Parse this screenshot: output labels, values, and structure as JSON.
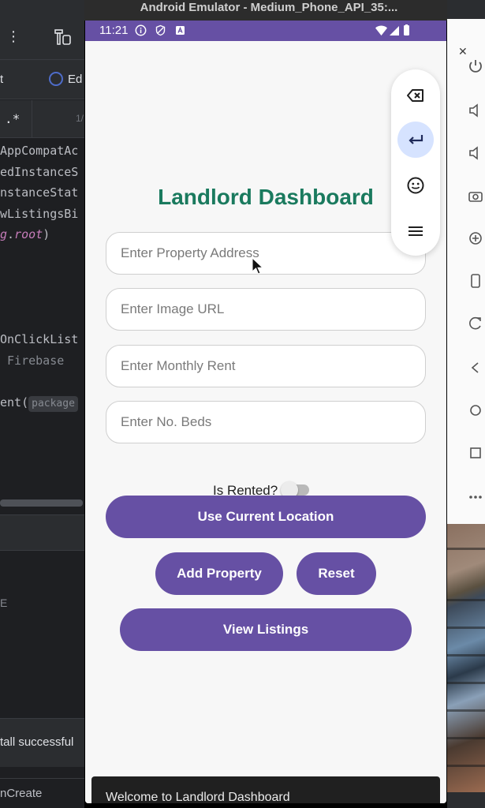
{
  "ide": {
    "find_regex": ".*",
    "find_count": "1/",
    "tab_left": "t",
    "tab_right": "Ed",
    "code_lines": [
      {
        "text": "AppCompatAc",
        "style": "plain"
      },
      {
        "text": "edInstanceS",
        "style": "plain"
      },
      {
        "text": "nstanceStat",
        "style": "plain"
      },
      {
        "text": "wListingsBi",
        "style": "plain"
      },
      {
        "text": "g.root)",
        "style": "root"
      },
      {
        "text": "",
        "style": "plain"
      },
      {
        "text": "",
        "style": "plain"
      },
      {
        "text": "",
        "style": "plain"
      },
      {
        "text": "",
        "style": "plain"
      },
      {
        "text": "OnClickList",
        "style": "plain"
      },
      {
        "text": "Firebase",
        "style": "grey"
      },
      {
        "text": "",
        "style": "plain"
      },
      {
        "text": "ent(",
        "style": "chip",
        "chip": "package"
      }
    ],
    "panel_mark": "E",
    "status_text": "tall successful",
    "crumb_text": "nCreate"
  },
  "emulator": {
    "window_title": "Android Emulator - Medium_Phone_API_35:...",
    "status_time": "11:21"
  },
  "app": {
    "title": "Landlord Dashboard",
    "fields": [
      {
        "name": "property-address-field",
        "placeholder": "Enter Property Address",
        "value": ""
      },
      {
        "name": "image-url-field",
        "placeholder": "Enter Image URL",
        "value": ""
      },
      {
        "name": "monthly-rent-field",
        "placeholder": "Enter Monthly Rent",
        "value": ""
      },
      {
        "name": "no-beds-field",
        "placeholder": "Enter No. Beds",
        "value": ""
      }
    ],
    "rented_label": "Is Rented?",
    "rented_on": false,
    "use_location_label": "Use Current Location",
    "add_property_label": "Add Property",
    "reset_label": "Reset",
    "view_listings_label": "View Listings",
    "toast": "Welcome to Landlord Dashboard",
    "colors": {
      "primary": "#6650a4",
      "title": "#1a7a5e",
      "status_bar": "#6650a4"
    }
  },
  "floating_panel": {
    "icons": [
      "backspace-icon",
      "enter-icon",
      "emoji-icon",
      "menu-icon"
    ],
    "active": "enter-icon"
  }
}
